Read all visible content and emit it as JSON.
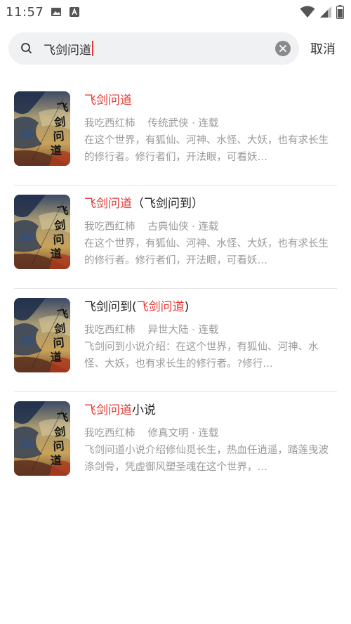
{
  "status_bar": {
    "time": "11:57"
  },
  "search": {
    "query": "飞剑问道",
    "cancel_label": "取消"
  },
  "results": [
    {
      "title_hl": "飞剑问道",
      "title_post": "",
      "title_pre": "",
      "author": "我吃西红柿",
      "category": "传统武侠 · 连载",
      "description": "在这个世界，有狐仙、河神、水怪、大妖，也有求长生的修行者。修行者们，开法眼，可看妖…"
    },
    {
      "title_hl": "飞剑问道",
      "title_post": "（飞剑问到）",
      "title_pre": "",
      "author": "我吃西红柿",
      "category": "古典仙侠 · 连载",
      "description": "在这个世界，有狐仙、河神、水怪、大妖，也有求长生的修行者。修行者们，开法眼，可看妖…"
    },
    {
      "title_pre": "飞剑问到(",
      "title_hl": "飞剑问道",
      "title_post": ")",
      "author": "我吃西红柿",
      "category": "异世大陆 · 连载",
      "description": "飞剑问到小说介绍：在这个世界，有狐仙、河神、水怪、大妖，也有求长生的修行者。?修行…"
    },
    {
      "title_pre": "",
      "title_hl": "飞剑问道",
      "title_post": "小说",
      "author": "我吃西红柿",
      "category": "修真文明 · 连载",
      "description": "飞剑问道小说介绍修仙觅长生，热血任逍遥，踏莲曳波涤剑骨，凭虚御风塑圣魂在这个世界，…"
    }
  ],
  "colors": {
    "highlight": "#e53935",
    "meta": "#9a9a9a",
    "search_bg": "#f0f1f3"
  },
  "icons": [
    "image-icon",
    "notification-a-icon",
    "wifi-icon",
    "signal-icon",
    "battery-icon",
    "search-icon",
    "clear-icon",
    "book-cover-image"
  ]
}
